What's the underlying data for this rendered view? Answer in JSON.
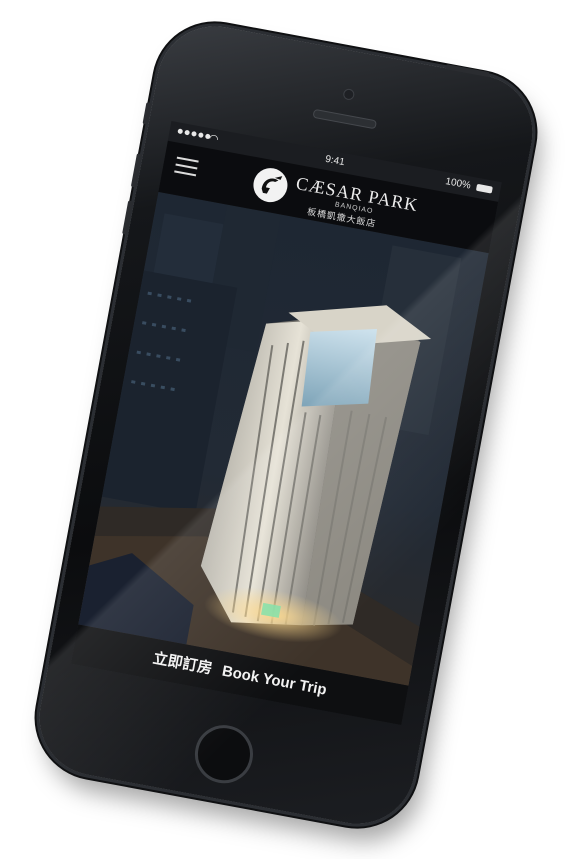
{
  "status_bar": {
    "time": "9:41",
    "battery": "100%",
    "signal_icon": "signal-dots-icon",
    "wifi_icon": "wifi-icon",
    "battery_icon": "battery-icon"
  },
  "header": {
    "menu_icon": "hamburger-menu-icon",
    "logo_icon": "caesar-helmet-logo-icon",
    "brand_name": "CÆSAR PARK",
    "brand_location": "BANQIAO",
    "brand_chinese": "板橋凱撒大飯店"
  },
  "hero": {
    "image": "hotel-tower-night-photo"
  },
  "book_bar": {
    "label_zh": "立即訂房",
    "label_en": "Book Your Trip"
  },
  "colors": {
    "header_bg": "#0a0b0d",
    "book_bar_bg": "#0e0f11",
    "text": "#f2f2f2",
    "phone_body": "#0b0c0e"
  }
}
